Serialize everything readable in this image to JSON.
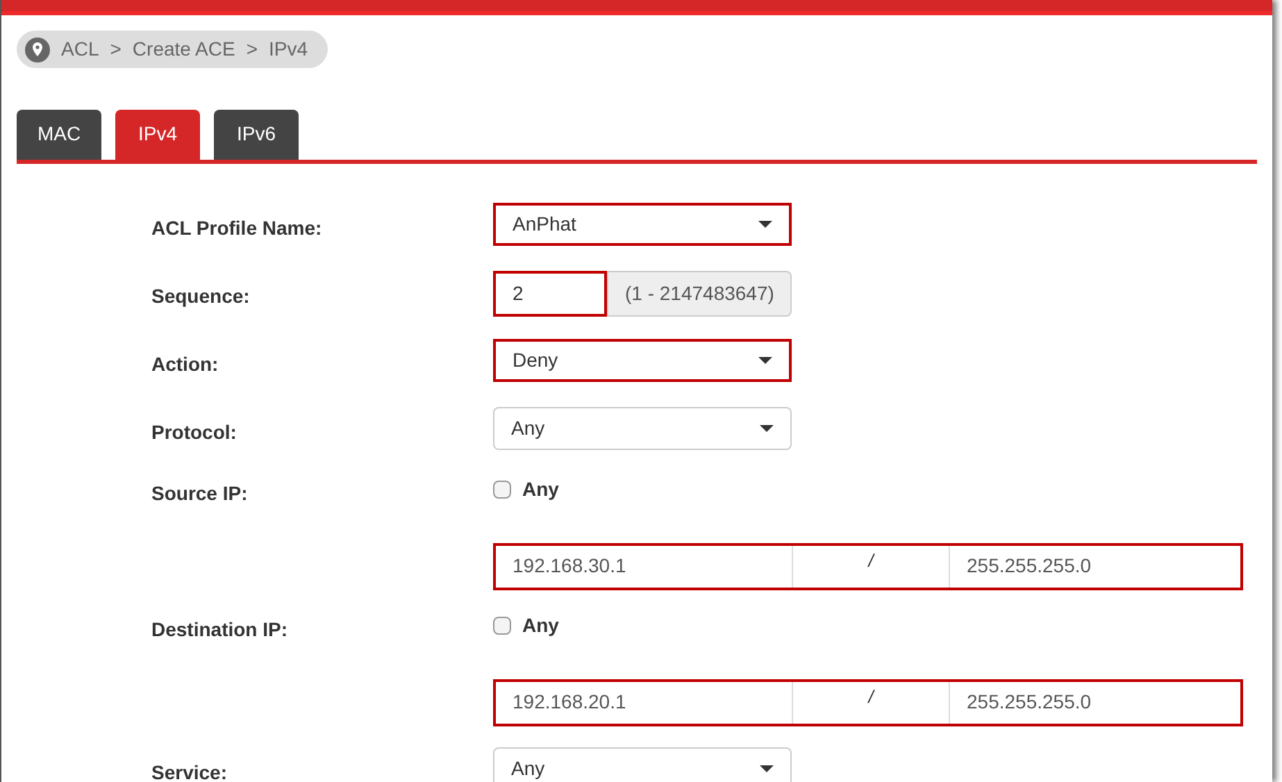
{
  "breadcrumb": [
    "ACL",
    ">",
    "Create ACE",
    ">",
    "IPv4"
  ],
  "tabs": [
    {
      "label": "MAC",
      "selected": false
    },
    {
      "label": "IPv4",
      "selected": true
    },
    {
      "label": "IPv6",
      "selected": false
    }
  ],
  "form": [
    {
      "kind": "select",
      "label": "ACL Profile Name:",
      "value": "AnPhat",
      "highlighted": true
    },
    {
      "kind": "range",
      "label": "Sequence:",
      "value": "2",
      "range": "(1 - 2147483647)",
      "highlighted": true
    },
    {
      "kind": "select",
      "label": "Action:",
      "value": "Deny",
      "highlighted": true
    },
    {
      "kind": "select",
      "label": "Protocol:",
      "value": "Any",
      "highlighted": false
    },
    {
      "kind": "checkbox",
      "label": "Source IP:",
      "option": "Any",
      "checked": false
    },
    {
      "kind": "ipmask",
      "address": "192.168.30.1",
      "separator": "/",
      "mask": "255.255.255.0",
      "highlighted": true
    },
    {
      "kind": "checkbox",
      "label": "Destination IP:",
      "option": "Any",
      "checked": false
    },
    {
      "kind": "ipmask",
      "address": "192.168.20.1",
      "separator": "/",
      "mask": "255.255.255.0",
      "highlighted": true
    },
    {
      "kind": "select",
      "label": "Service:",
      "value": "Any",
      "highlighted": false
    }
  ]
}
